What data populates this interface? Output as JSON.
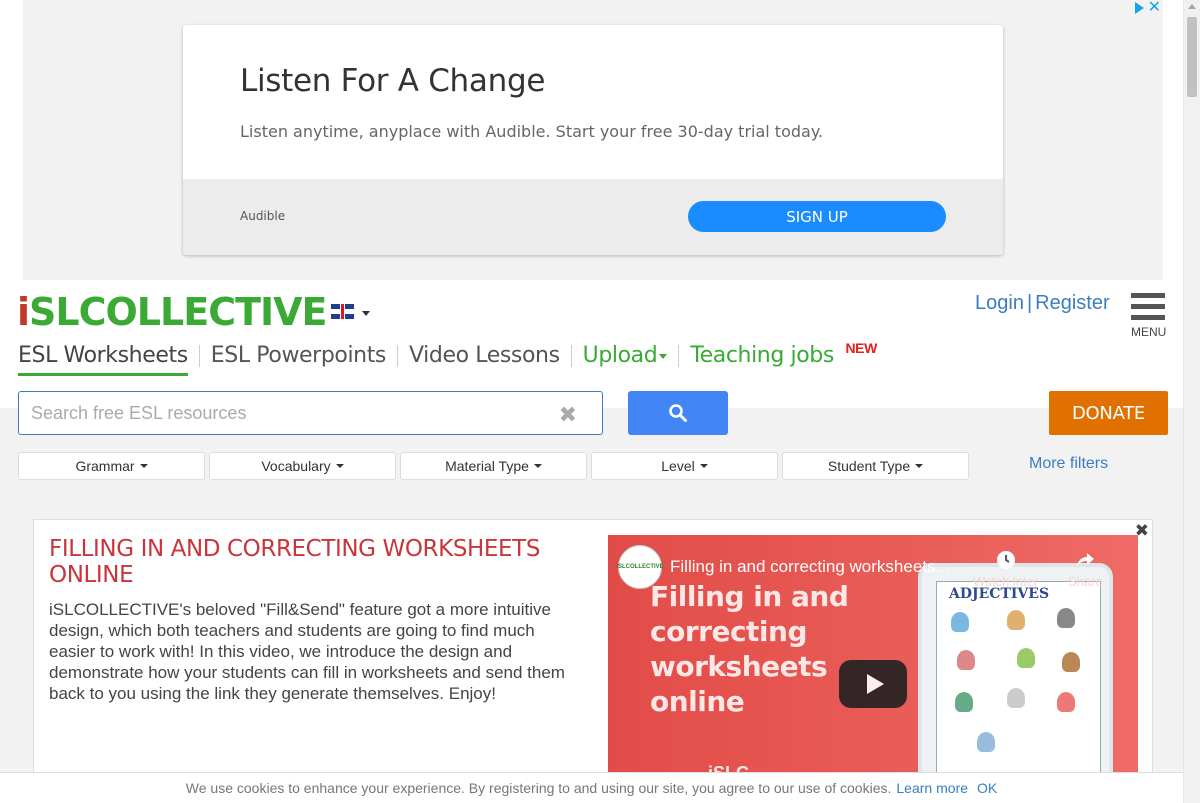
{
  "ad": {
    "title": "Listen For A Change",
    "description": "Listen anytime, anyplace with Audible. Start your free 30-day trial today.",
    "brand": "Audible",
    "cta": "SIGN UP"
  },
  "header": {
    "logo_i": "i",
    "logo_rest": "SLCOLLECTIVE",
    "login": "Login",
    "separator": "|",
    "register": "Register",
    "menu_label": "MENU"
  },
  "nav": {
    "items": [
      {
        "label": "ESL Worksheets"
      },
      {
        "label": "ESL Powerpoints"
      },
      {
        "label": "Video Lessons"
      },
      {
        "label": "Upload"
      },
      {
        "label": "Teaching jobs",
        "badge": "NEW"
      }
    ]
  },
  "search": {
    "placeholder": "Search free ESL resources",
    "clear_glyph": "✖"
  },
  "donate_label": "DONATE",
  "filters": {
    "items": [
      {
        "label": "Grammar"
      },
      {
        "label": "Vocabulary"
      },
      {
        "label": "Material Type"
      },
      {
        "label": "Level"
      },
      {
        "label": "Student Type"
      }
    ],
    "more": "More filters"
  },
  "feature": {
    "close_glyph": "✖",
    "title": "FILLING IN AND CORRECTING WORKSHEETS ONLINE",
    "text": "iSLCOLLECTIVE's beloved \"Fill&Send\" feature got a more intuitive design, which both teachers and students are going to find much easier to work with! In this video, we introduce the design and demonstrate how your students can fill in worksheets and send them back to you using the link they generate themselves. Enjoy!",
    "video": {
      "channel": "iSLCOLLECTIVE",
      "title": "Filling in and correcting worksheets...",
      "headline_1": "Filling in and",
      "headline_2": "correcting",
      "headline_3": "worksheets",
      "headline_4": "online",
      "watch_later": "Watch later",
      "share": "Share",
      "sheet_title": "ADJECTIVES",
      "bottom_text": "iSLC"
    }
  },
  "cookie": {
    "text": "We use cookies to enhance your experience. By registering to and using our site, you agree to our use of cookies.",
    "learn_more": "Learn more",
    "ok": "OK"
  },
  "colors": {
    "brand_green": "#3aaa35",
    "logo_red": "#c0392b",
    "link_blue": "#3a7ec1",
    "search_blue": "#4285f4",
    "donate_orange": "#e07000",
    "feature_red": "#c9353a"
  }
}
